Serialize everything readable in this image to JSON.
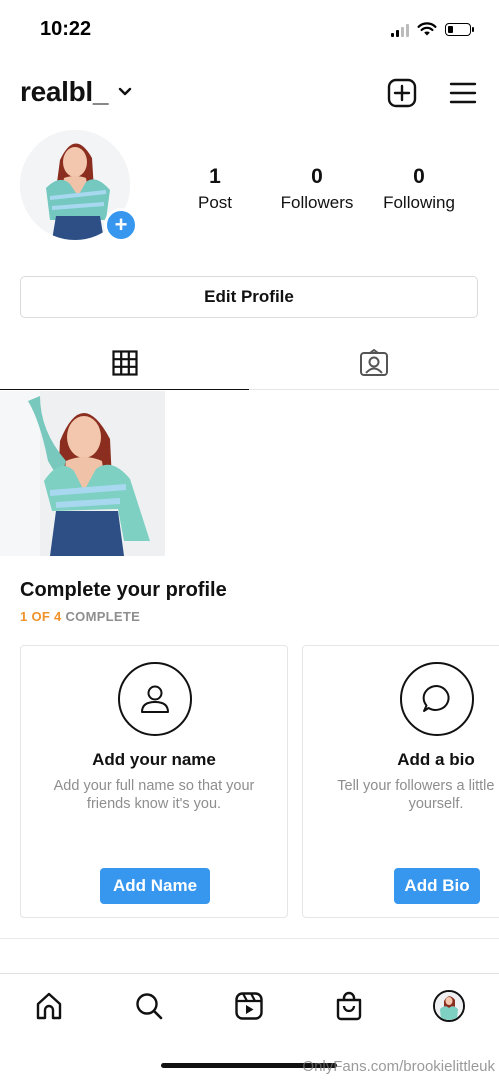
{
  "status_bar": {
    "time": "10:22",
    "icons": [
      "signal-icon",
      "wifi-icon",
      "battery-icon"
    ],
    "battery_level": 0.2
  },
  "header": {
    "username": "realbl_",
    "icons": [
      "chevron-down-icon",
      "new-post-icon",
      "menu-icon"
    ]
  },
  "profile": {
    "stats": [
      {
        "value": "1",
        "label": "Post"
      },
      {
        "value": "0",
        "label": "Followers"
      },
      {
        "value": "0",
        "label": "Following"
      }
    ],
    "add_badge": "+"
  },
  "edit_profile_label": "Edit Profile",
  "tabs": [
    "grid-icon",
    "tagged-icon"
  ],
  "complete_profile": {
    "title": "Complete your profile",
    "progress_done": "1 OF 4",
    "progress_rest": "COMPLETE",
    "cards": [
      {
        "icon": "user-icon",
        "title": "Add your name",
        "desc": "Add your full name so that your friends know it's you.",
        "button": "Add Name"
      },
      {
        "icon": "speech-bubble-icon",
        "title": "Add a bio",
        "desc": "Tell your followers a little about yourself.",
        "button": "Add Bio"
      }
    ]
  },
  "bottom_nav": [
    "home-icon",
    "search-icon",
    "reels-icon",
    "shop-icon",
    "profile-avatar"
  ],
  "watermark": "OnlyFans.com/brookielittleuk",
  "colors": {
    "accent_blue": "#3797ef",
    "progress_orange": "#f0922b",
    "muted_gray": "#8e8e8e",
    "border_gray": "#dbdbdb"
  }
}
